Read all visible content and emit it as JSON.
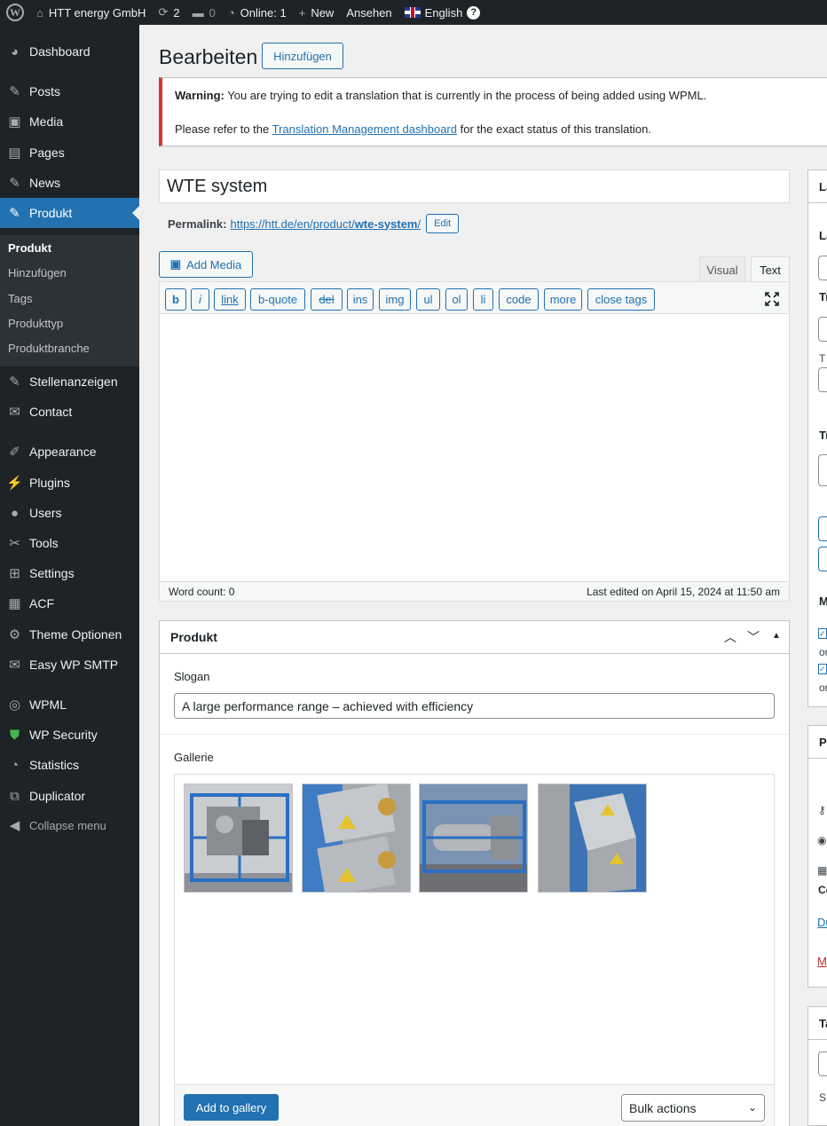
{
  "admin_bar": {
    "site_name": "HTT energy GmbH",
    "updates_count": "2",
    "comments_count": "0",
    "online": "Online: 1",
    "new_label": "New",
    "view_label": "Ansehen",
    "language": "English"
  },
  "sidebar": {
    "items": [
      {
        "label": "Dashboard",
        "icon": "dashboard-icon"
      },
      {
        "label": "Posts",
        "icon": "pin-icon"
      },
      {
        "label": "Media",
        "icon": "media-icon"
      },
      {
        "label": "Pages",
        "icon": "pages-icon"
      },
      {
        "label": "News",
        "icon": "pin-icon"
      },
      {
        "label": "Produkt",
        "icon": "pin-icon"
      },
      {
        "label": "Stellenanzeigen",
        "icon": "pin-icon"
      },
      {
        "label": "Contact",
        "icon": "mail-icon"
      },
      {
        "label": "Appearance",
        "icon": "brush-icon"
      },
      {
        "label": "Plugins",
        "icon": "plugin-icon"
      },
      {
        "label": "Users",
        "icon": "user-icon"
      },
      {
        "label": "Tools",
        "icon": "wrench-icon"
      },
      {
        "label": "Settings",
        "icon": "settings-icon"
      },
      {
        "label": "ACF",
        "icon": "grid-icon"
      },
      {
        "label": "Theme Optionen",
        "icon": "gear-icon"
      },
      {
        "label": "Easy WP SMTP",
        "icon": "envelope-icon"
      },
      {
        "label": "WPML",
        "icon": "wpml-icon"
      },
      {
        "label": "WP Security",
        "icon": "shield-icon"
      },
      {
        "label": "Statistics",
        "icon": "pie-icon"
      },
      {
        "label": "Duplicator",
        "icon": "duplicate-icon"
      }
    ],
    "submenu": [
      "Produkt",
      "Hinzufügen",
      "Tags",
      "Produkttyp",
      "Produktbranche"
    ],
    "collapse_label": "Collapse menu"
  },
  "page": {
    "title": "Bearbeiten",
    "add_new_label": "Hinzufügen"
  },
  "notice": {
    "warning_bold": "Warning:",
    "warning_text": "You are trying to edit a translation that is currently in the process of being added using WPML.",
    "line2_prefix": "Please refer to the",
    "line2_link": "Translation Management dashboard",
    "line2_suffix": "for the exact status of this translation."
  },
  "post": {
    "title": "WTE system",
    "permalink_label": "Permalink:",
    "permalink_url_prefix": "https://htt.de/en/product/",
    "permalink_slug": "wte-system",
    "permalink_url_suffix": "/",
    "edit_label": "Edit"
  },
  "editor": {
    "add_media": "Add Media",
    "tab_visual": "Visual",
    "tab_text": "Text",
    "quicktags": [
      "b",
      "i",
      "link",
      "b-quote",
      "del",
      "ins",
      "img",
      "ul",
      "ol",
      "li",
      "code",
      "more",
      "close tags"
    ],
    "word_count": "Word count: 0",
    "last_edited": "Last edited on April 15, 2024 at 11:50 am"
  },
  "produkt_box": {
    "title": "Produkt",
    "slogan_label": "Slogan",
    "slogan_value": "A large performance range – achieved with efficiency",
    "gallery_label": "Gallerie",
    "add_to_gallery": "Add to gallery",
    "bulk_actions": "Bulk actions"
  },
  "right_column": {
    "frag_1": "La",
    "frag_2": "La",
    "frag_3": "Tr",
    "frag_4": "T",
    "frag_5": "Tr",
    "frag_6": "M",
    "frag_7": "or",
    "frag_8": "or",
    "frag_9": "P",
    "frag_10": "Co",
    "frag_11": "Du",
    "frag_12": "M",
    "frag_13": "Ta",
    "frag_14": "S"
  }
}
